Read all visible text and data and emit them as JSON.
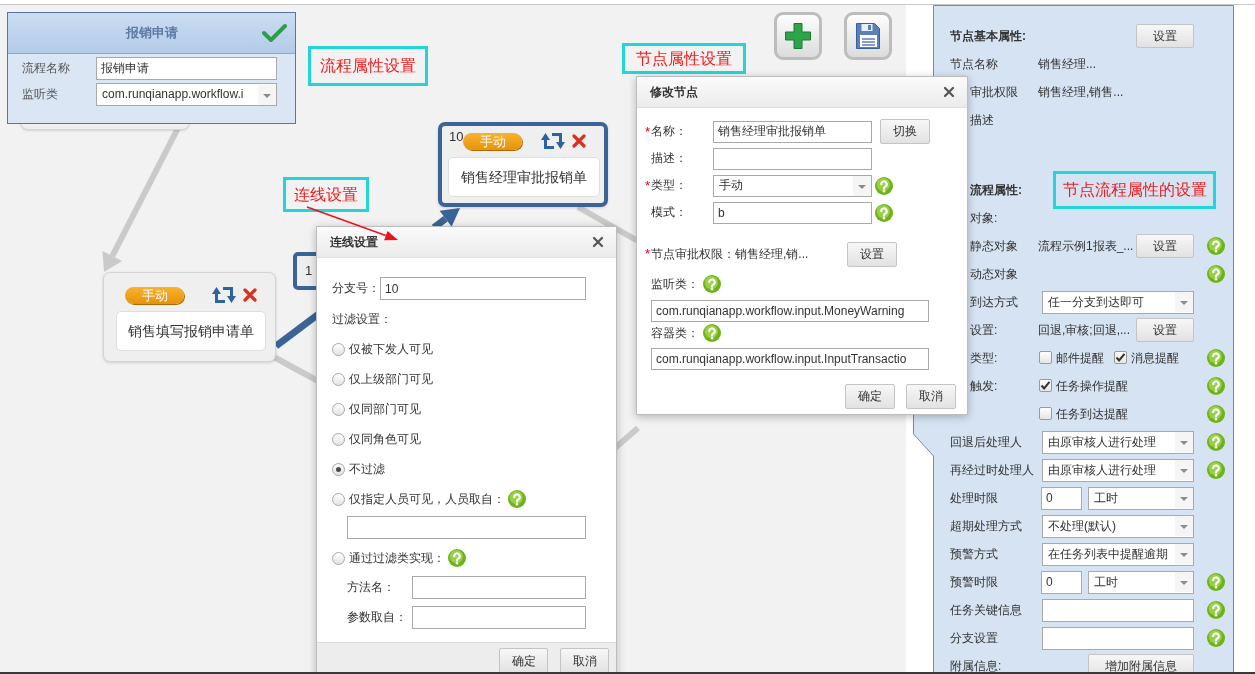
{
  "process_panel": {
    "title": "报销申请",
    "fields": [
      {
        "label": "流程名称",
        "kind": "input",
        "value": "报销申请"
      },
      {
        "label": "监听类",
        "kind": "select",
        "value": "com.runqianapp.workflow.i"
      }
    ]
  },
  "annotations": [
    "流程属性设置",
    "连线设置",
    "节点属性设置",
    "节点流程属性的设置"
  ],
  "diagram": {
    "nodes": [
      {
        "type": "手动",
        "title": "销售填写报销申请单",
        "selected": false
      },
      {
        "number": "10",
        "type": "手动",
        "title": "销售经理审批报销单",
        "selected": true
      }
    ],
    "connectors": [
      {
        "selected": false
      },
      {
        "selected": true,
        "label": "1"
      },
      {
        "selected": false
      },
      {
        "selected": false
      },
      {
        "selected": false
      }
    ]
  },
  "link_dialog": {
    "title": "连线设置",
    "branch": {
      "label": "分支号：",
      "value": "10"
    },
    "filter_label": "过滤设置：",
    "options": [
      {
        "label": "仅被下发人可见",
        "selected": false,
        "help": false,
        "kind": "plain"
      },
      {
        "label": "仅上级部门可见",
        "selected": false,
        "help": false,
        "kind": "plain"
      },
      {
        "label": "仅同部门可见",
        "selected": false,
        "help": false,
        "kind": "plain"
      },
      {
        "label": "仅同角色可见",
        "selected": false,
        "help": false,
        "kind": "plain"
      },
      {
        "label": "不过滤",
        "selected": true,
        "help": false,
        "kind": "plain"
      },
      {
        "label": "仅指定人员可见，人员取自：",
        "selected": false,
        "help": true,
        "kind": "with_field"
      },
      {
        "label": "通过过滤类实现：",
        "selected": false,
        "help": true,
        "kind": "with_fields",
        "fields": [
          {
            "label": "方法名："
          },
          {
            "label": "参数取自："
          }
        ]
      }
    ],
    "buttons": [
      "确定",
      "取消"
    ]
  },
  "node_dialog": {
    "title": "修改节点",
    "fields": [
      {
        "required_mark": "*",
        "label": "名称：",
        "kind": "input",
        "value": "销售经理审批报销单",
        "button": "切换",
        "help": false
      },
      {
        "label": "描述：",
        "kind": "input",
        "help": false
      },
      {
        "required_mark": "*",
        "label": "类型：",
        "kind": "select",
        "value": "手动",
        "help": true
      },
      {
        "label": "模式：",
        "kind": "input",
        "value": "b",
        "help": true
      }
    ],
    "permission": {
      "required_mark": "*",
      "text": "节点审批权限：销售经理,销...",
      "button": "设置"
    },
    "class_fields": [
      {
        "label": "监听类：",
        "help": true,
        "value": "com.runqianapp.workflow.input.MoneyWarning"
      },
      {
        "label": "容器类：",
        "help": true,
        "value": "com.runqianapp.workflow.input.InputTransactio"
      }
    ],
    "buttons": [
      "确定",
      "取消"
    ]
  },
  "node_panel": {
    "rows": [
      {
        "kind": "heading",
        "label": "节点基本属性:",
        "button": "设置",
        "help": false
      },
      {
        "kind": "text",
        "label": "节点名称",
        "value": "销售经理...",
        "help": false
      },
      {
        "kind": "text",
        "label": "审批权限",
        "value": "销售经理,销售...",
        "help": false
      },
      {
        "kind": "text",
        "label": "描述",
        "help": false
      },
      {
        "kind": "heading",
        "label": "流程属性:",
        "help": false
      },
      {
        "kind": "text",
        "label": "对象:",
        "help": false
      },
      {
        "kind": "text",
        "label": "静态对象",
        "value": "流程示例1报表_...",
        "button": "设置",
        "help": true
      },
      {
        "kind": "text",
        "label": "动态对象",
        "help": true
      },
      {
        "kind": "select",
        "label": "到达方式",
        "value": "任一分支到达即可",
        "help": false
      },
      {
        "kind": "text",
        "label": "设置:",
        "value": "回退,审核;回退,...",
        "button": "设置",
        "help": false
      },
      {
        "kind": "checks",
        "label": "类型:",
        "checks": [
          {
            "label": "邮件提醒",
            "checked": false
          },
          {
            "label": "消息提醒",
            "checked": true
          }
        ],
        "help": true
      },
      {
        "kind": "checks",
        "label": "触发:",
        "checks": [
          {
            "label": "任务操作提醒",
            "checked": true
          }
        ],
        "help": true
      },
      {
        "kind": "checks",
        "checks": [
          {
            "label": "任务到达提醒",
            "checked": false
          }
        ],
        "help": true
      },
      {
        "kind": "select",
        "label": "回退后处理人",
        "value": "由原审核人进行处理",
        "help": true
      },
      {
        "kind": "select",
        "label": "再经过时处理人",
        "value": "由原审核人进行处理",
        "help": true
      },
      {
        "kind": "time",
        "label": "处理时限",
        "value": "0",
        "unit": "工时",
        "help": false
      },
      {
        "kind": "select",
        "label": "超期处理方式",
        "value": "不处理(默认)",
        "help": false
      },
      {
        "kind": "select",
        "label": "预警方式",
        "value": "在任务列表中提醒逾期",
        "help": false
      },
      {
        "kind": "time",
        "label": "预警时限",
        "value": "0",
        "unit": "工时",
        "help": true
      },
      {
        "kind": "input",
        "label": "任务关键信息",
        "help": true
      },
      {
        "kind": "input",
        "label": "分支设置",
        "help": true
      },
      {
        "kind": "text",
        "label": "附属信息:",
        "button": "增加附属信息",
        "help": false
      }
    ]
  }
}
